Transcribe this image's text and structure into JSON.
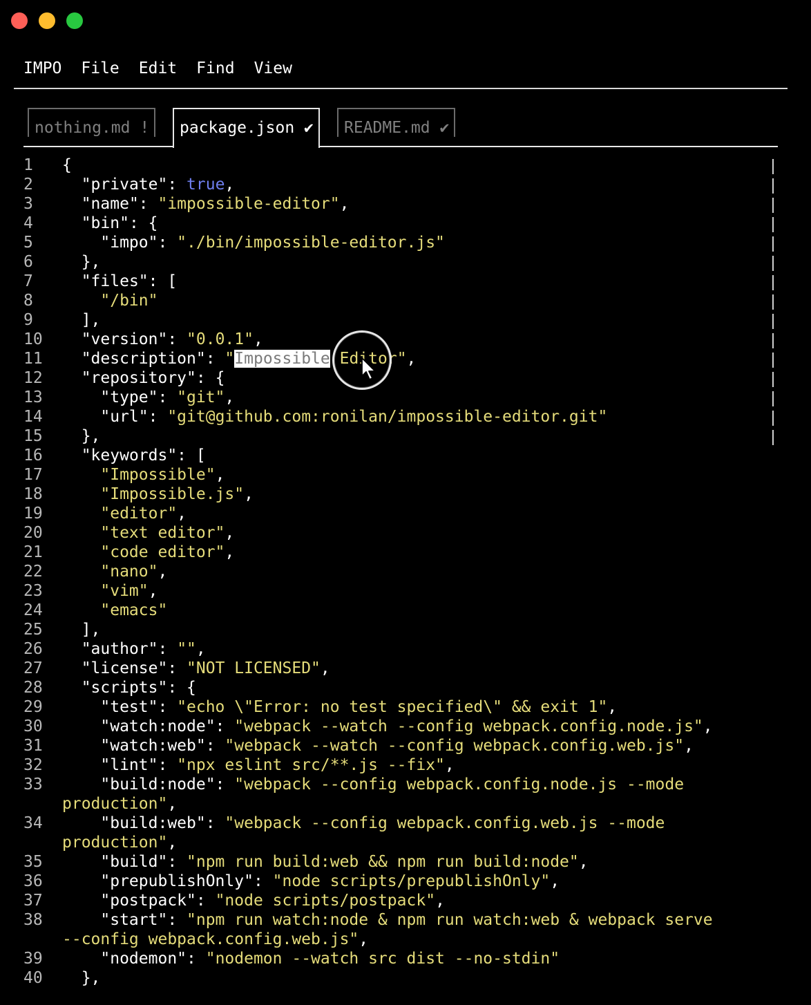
{
  "menu": {
    "items": [
      "IMPO",
      "File",
      "Edit",
      "Find",
      "View"
    ]
  },
  "tabs": [
    {
      "label": "nothing.md !",
      "active": false
    },
    {
      "label": "package.json ✔",
      "active": true
    },
    {
      "label": "README.md ✔",
      "active": false
    }
  ],
  "colors": {
    "string": "#e5dc7a",
    "keyword": "#6f7ff0",
    "selection_bg": "#ffffff"
  },
  "selection": {
    "text": "Impossible",
    "line": 11
  },
  "lines": [
    {
      "n": "1",
      "html": "{"
    },
    {
      "n": "2",
      "html": "  \"private\": <kw>true</kw>,"
    },
    {
      "n": "3",
      "html": "  \"name\": <s>\"impossible-editor\"</s>,"
    },
    {
      "n": "4",
      "html": "  \"bin\": {"
    },
    {
      "n": "5",
      "html": "    \"impo\": <s>\"./bin/impossible-editor.js\"</s>"
    },
    {
      "n": "6",
      "html": "  },"
    },
    {
      "n": "7",
      "html": "  \"files\": ["
    },
    {
      "n": "8",
      "html": "    <s>\"/bin\"</s>"
    },
    {
      "n": "9",
      "html": "  ],"
    },
    {
      "n": "10",
      "html": "  \"version\": <s>\"0.0.1\"</s>,"
    },
    {
      "n": "11",
      "html": "  \"description\": <s>\"<sel>Impossible</sel> Editor\"</s>,"
    },
    {
      "n": "12",
      "html": "  \"repository\": {"
    },
    {
      "n": "13",
      "html": "    \"type\": <s>\"git\"</s>,"
    },
    {
      "n": "14",
      "html": "    \"url\": <s>\"git@github.com:ronilan/impossible-editor.git\"</s>"
    },
    {
      "n": "15",
      "html": "  },"
    },
    {
      "n": "16",
      "html": "  \"keywords\": ["
    },
    {
      "n": "17",
      "html": "    <s>\"Impossible\"</s>,"
    },
    {
      "n": "18",
      "html": "    <s>\"Impossible.js\"</s>,"
    },
    {
      "n": "19",
      "html": "    <s>\"editor\"</s>,"
    },
    {
      "n": "20",
      "html": "    <s>\"text editor\"</s>,"
    },
    {
      "n": "21",
      "html": "    <s>\"code editor\"</s>,"
    },
    {
      "n": "22",
      "html": "    <s>\"nano\"</s>,"
    },
    {
      "n": "23",
      "html": "    <s>\"vim\"</s>,"
    },
    {
      "n": "24",
      "html": "    <s>\"emacs\"</s>"
    },
    {
      "n": "25",
      "html": "  ],"
    },
    {
      "n": "26",
      "html": "  \"author\": <s>\"\"</s>,"
    },
    {
      "n": "27",
      "html": "  \"license\": <s>\"NOT LICENSED\"</s>,"
    },
    {
      "n": "28",
      "html": "  \"scripts\": {"
    },
    {
      "n": "29",
      "html": "    \"test\": <s>\"echo \\\"Error: no test specified\\\" &amp;&amp; exit 1\"</s>,"
    },
    {
      "n": "30",
      "html": "    \"watch:node\": <s>\"webpack --watch --config webpack.config.node.js\"</s>,"
    },
    {
      "n": "31",
      "html": "    \"watch:web\": <s>\"webpack --watch --config webpack.config.web.js\"</s>,"
    },
    {
      "n": "32",
      "html": "    \"lint\": <s>\"npx eslint src/**.js --fix\"</s>,"
    },
    {
      "n": "33",
      "wrap": true,
      "html": "    \"build:node\": <s>\"webpack --config webpack.config.node.js --mode</s>\n<s>production\"</s>,"
    },
    {
      "n": "34",
      "wrap": true,
      "html": "    \"build:web\": <s>\"webpack --config webpack.config.web.js --mode</s>\n<s>production\"</s>,"
    },
    {
      "n": "35",
      "html": "    \"build\": <s>\"npm run build:web &amp;&amp; npm run build:node\"</s>,"
    },
    {
      "n": "36",
      "html": "    \"prepublishOnly\": <s>\"node scripts/prepublishOnly\"</s>,"
    },
    {
      "n": "37",
      "html": "    \"postpack\": <s>\"node scripts/postpack\"</s>,"
    },
    {
      "n": "38",
      "wrap": true,
      "html": "    \"start\": <s>\"npm run watch:node &amp; npm run watch:web &amp; webpack serve</s>\n<s>--config webpack.config.web.js\"</s>,"
    },
    {
      "n": "39",
      "html": "    \"nodemon\": <s>\"nodemon --watch src dist --no-stdin\"</s>"
    },
    {
      "n": "40",
      "html": "  },"
    }
  ]
}
